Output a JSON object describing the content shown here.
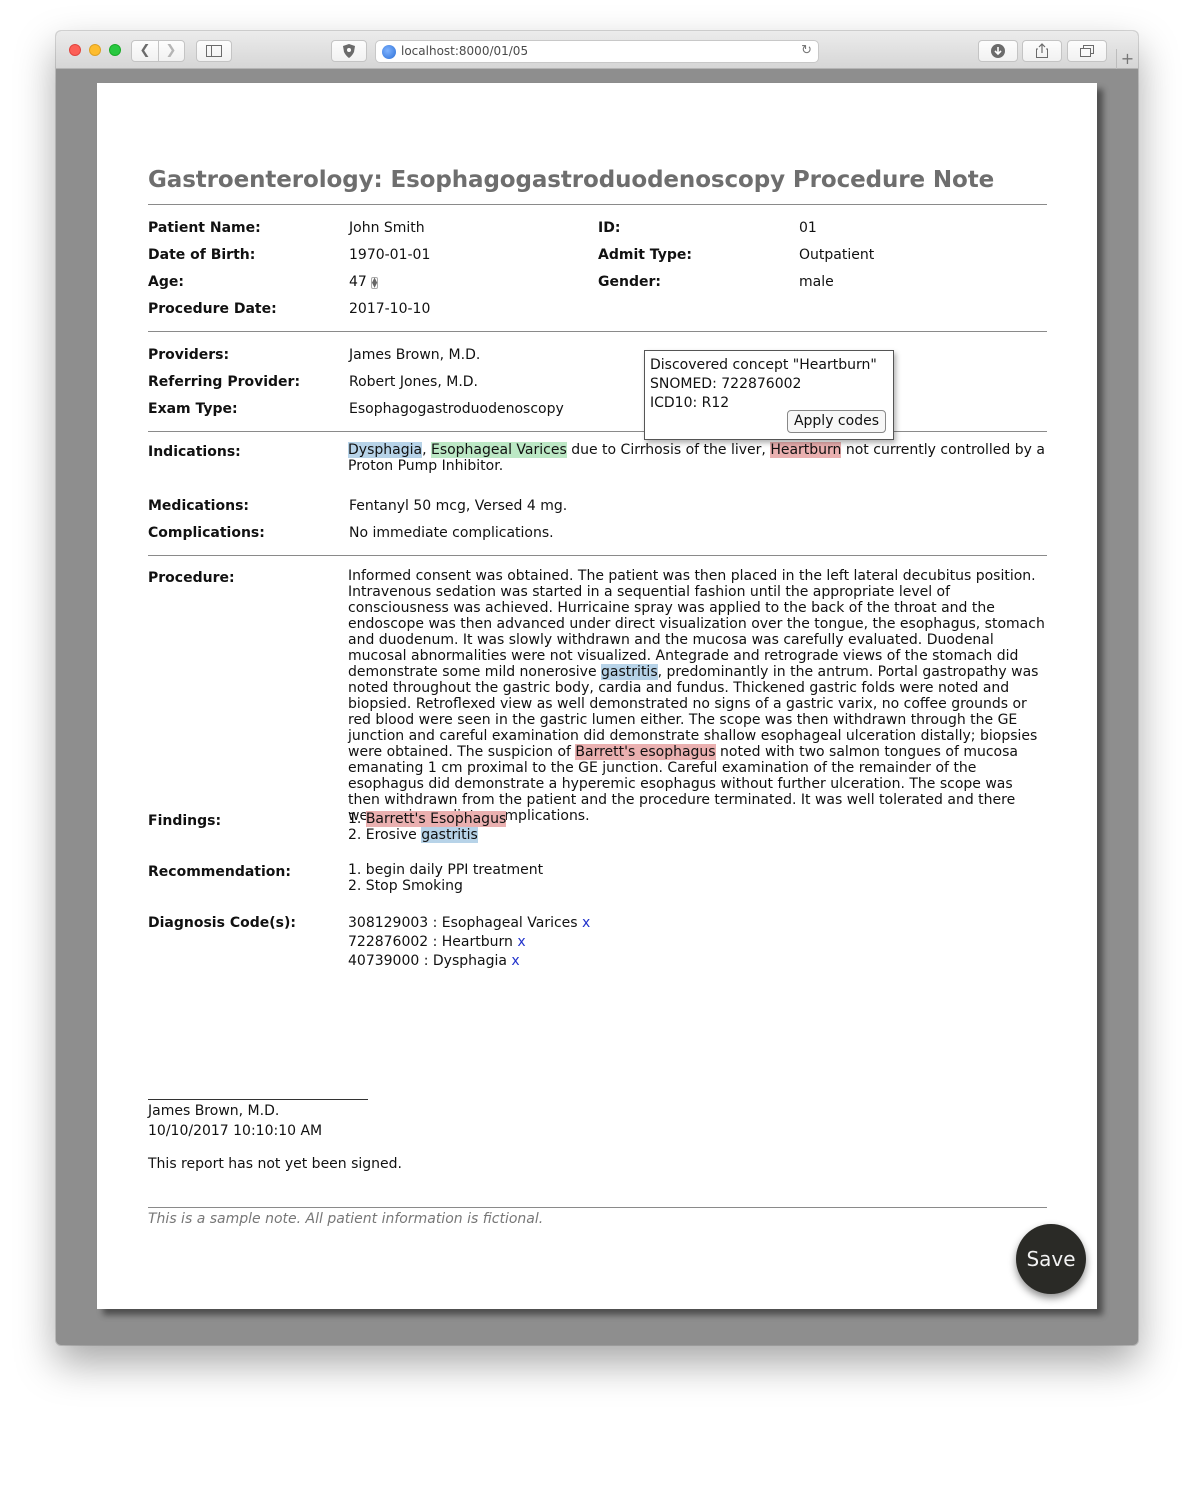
{
  "browser": {
    "url": "localhost:8000/01/05",
    "icons": [
      "back-icon",
      "forward-icon",
      "sidebar-icon",
      "shield-icon",
      "globe-icon",
      "reload-icon",
      "download-icon",
      "share-icon",
      "tabs-icon",
      "new-tab-icon"
    ]
  },
  "note": {
    "title": "Gastroenterology: Esophagogastroduodenoscopy Procedure Note",
    "patient": {
      "name_label": "Patient Name:",
      "name": "John Smith",
      "id_label": "ID:",
      "id": "01",
      "dob_label": "Date of Birth:",
      "dob": "1970-01-01",
      "admit_label": "Admit Type:",
      "admit": "Outpatient",
      "age_label": "Age:",
      "age": "47",
      "gender_label": "Gender:",
      "gender": "male",
      "procedure_date_label": "Procedure Date:",
      "procedure_date": "2017-10-10"
    },
    "providers": {
      "providers_label": "Providers:",
      "providers": "James Brown, M.D.",
      "referring_label": "Referring Provider:",
      "referring": "Robert Jones, M.D.",
      "exam_label": "Exam Type:",
      "exam": "Esophagogastroduodenoscopy"
    },
    "indications": {
      "label": "Indications:",
      "concept1": "Dysphagia",
      "sep1": ", ",
      "concept2": "Esophageal Varices",
      "text1": " due to Cirrhosis of the liver, ",
      "concept3": "Heartburn",
      "text2": " not currently controlled by a Proton Pump Inhibitor."
    },
    "medications_label": "Medications:",
    "medications": "Fentanyl 50 mcg, Versed 4 mg.",
    "complications_label": "Complications:",
    "complications": "No immediate complications.",
    "procedure": {
      "label": "Procedure:",
      "text1": "Informed consent was obtained. The patient was then placed in the left lateral decubitus position. Intravenous sedation was started in a sequential fashion until the appropriate level of consciousness was achieved. Hurricaine spray was applied to the back of the throat and the endoscope was then advanced under direct visualization over the tongue, the esophagus, stomach and duodenum. It was slowly withdrawn and the mucosa was carefully evaluated. Duodenal mucosal abnormalities were not visualized. Antegrade and retrograde views of the stomach did demonstrate some mild nonerosive ",
      "concept1": "gastritis",
      "text2": ", predominantly in the antrum. Portal gastropathy was noted throughout the gastric body, cardia and fundus. Thickened gastric folds were noted and biopsied. Retroflexed view as well demonstrated no signs of a gastric varix, no coffee grounds or red blood were seen in the gastric lumen either. The scope was then withdrawn through the GE junction and careful examination did demonstrate shallow esophageal ulceration distally; biopsies were obtained. The suspicion of ",
      "concept2": "Barrett's esophagus",
      "text3": " noted with two salmon tongues of mucosa emanating 1 cm proximal to the GE junction. Careful examination of the remainder of the esophagus did demonstrate a hyperemic esophagus without further ulceration. The scope was then withdrawn from the patient and the procedure terminated. It was well tolerated and there were no immediate complications."
    },
    "findings": {
      "label": "Findings:",
      "item1_prefix": "1. ",
      "item1_concept": "Barrett's Esophagus",
      "item2_prefix": "2. Erosive ",
      "item2_concept": "gastritis"
    },
    "recommendation": {
      "label": "Recommendation:",
      "items": [
        "1. begin daily PPI treatment",
        "2. Stop Smoking"
      ]
    },
    "diagnosis": {
      "label": "Diagnosis Code(s):",
      "codes": [
        {
          "text": "308129003 : Esophageal Varices",
          "remove": "x"
        },
        {
          "text": "722876002 : Heartburn",
          "remove": "x"
        },
        {
          "text": "40739000 : Dysphagia",
          "remove": "x"
        }
      ]
    },
    "signature": {
      "name": "James Brown, M.D.",
      "datetime": "10/10/2017 10:10:10 AM",
      "status": "This report has not yet been signed."
    },
    "footnote": "This is a sample note. All patient information is fictional."
  },
  "popup": {
    "line1": "Discovered concept \"Heartburn\"",
    "line2": "SNOMED: 722876002",
    "line3": "ICD10: R12",
    "apply_label": "Apply codes"
  },
  "save_label": "Save",
  "colors": {
    "highlight_blue": "#b7d3e8",
    "highlight_green": "#bce8c5",
    "highlight_red": "#eab0b0",
    "save_button": "#2a2a26",
    "remove_link": "#2233cc"
  }
}
